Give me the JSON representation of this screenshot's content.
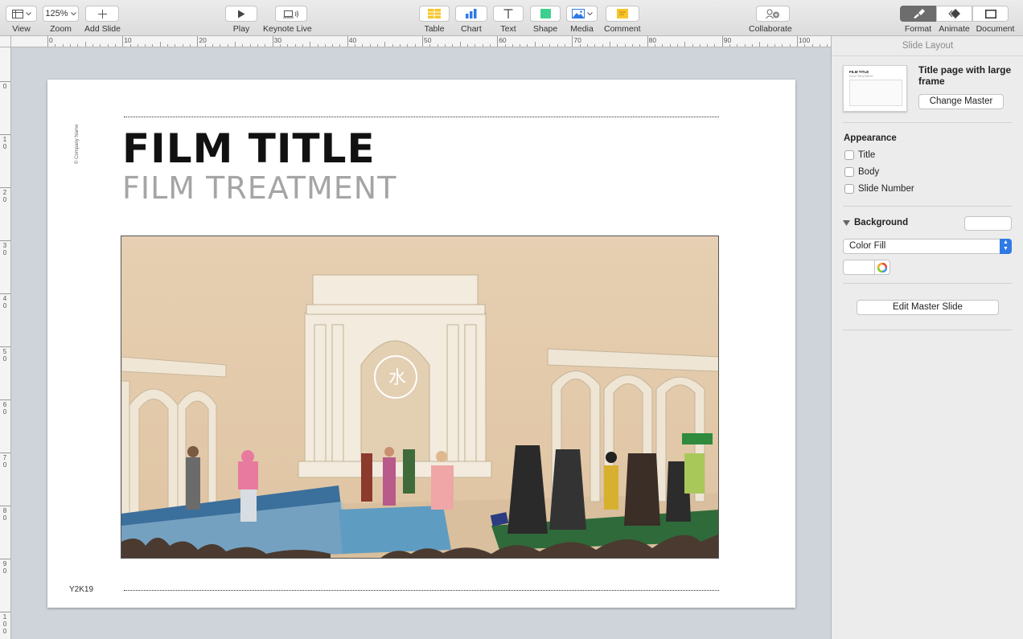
{
  "toolbar": {
    "view": "View",
    "zoom": "Zoom",
    "zoom_value": "125%",
    "add_slide": "Add Slide",
    "play": "Play",
    "keynote_live": "Keynote Live",
    "table": "Table",
    "chart": "Chart",
    "text": "Text",
    "shape": "Shape",
    "media": "Media",
    "comment": "Comment",
    "collaborate": "Collaborate",
    "format": "Format",
    "animate": "Animate",
    "document": "Document"
  },
  "ruler": {
    "horizontal": [
      "0",
      "10",
      "20",
      "30",
      "40",
      "50",
      "60",
      "70",
      "80",
      "90",
      "100"
    ],
    "vertical": [
      "0",
      "10",
      "20",
      "30",
      "40",
      "50",
      "60",
      "70",
      "80",
      "90",
      "100"
    ]
  },
  "slide": {
    "company": "© Company Name",
    "title": "FILM TITLE",
    "subtitle": "FILM TREATMENT",
    "footer": "Y2K19"
  },
  "inspector": {
    "header": "Slide Layout",
    "master_name": "Title page with large frame",
    "change_master": "Change Master",
    "appearance": "Appearance",
    "checkbox_title": "Title",
    "checkbox_body": "Body",
    "checkbox_slide_number": "Slide Number",
    "background": "Background",
    "fill_type": "Color Fill",
    "edit_master": "Edit Master Slide",
    "thumb_title": "FILM TITLE",
    "thumb_sub": "FILM TREATMENT"
  },
  "colors": {
    "accent": "#2f7ae5",
    "toolbar_bg": "#e3e3e3",
    "canvas_bg": "#cfd4db",
    "photo_sky": "#e3c9a8"
  }
}
